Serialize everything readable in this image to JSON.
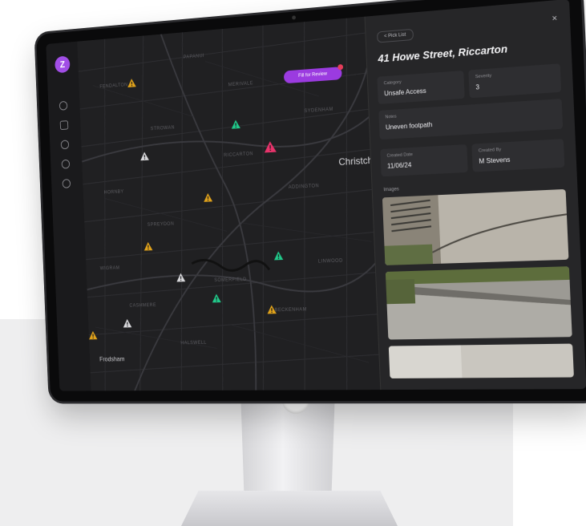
{
  "app": {
    "logo_letter": "Z",
    "accent_color": "#9b3be0"
  },
  "sidebar": {
    "items": [
      {
        "icon": "home-icon"
      },
      {
        "icon": "list-icon"
      },
      {
        "icon": "search-icon"
      },
      {
        "icon": "bell-icon"
      },
      {
        "icon": "settings-icon"
      }
    ]
  },
  "map": {
    "city_label": "Christchu",
    "suburb_label": "Frodsham",
    "filter_button_label": "Fill for Review",
    "street_labels": [
      "FENDALTON",
      "MERIVALE",
      "RICCARTON",
      "ADDINGTON",
      "SPREYDON",
      "SYDENHAM",
      "LINWOOD",
      "PAPANUI",
      "STROWAN",
      "BECKENHAM",
      "HALSWELL",
      "WIGRAM",
      "HORNBY",
      "SOMERFIELD",
      "CASHMERE"
    ],
    "markers": [
      {
        "status": "pending",
        "color": "#e0a21b"
      },
      {
        "status": "resolved",
        "color": "#21c98a"
      },
      {
        "status": "new",
        "color": "#d9d9dc"
      },
      {
        "status": "selected",
        "color": "#e8336b"
      },
      {
        "status": "pending",
        "color": "#e0a21b"
      },
      {
        "status": "pending",
        "color": "#e0a21b"
      },
      {
        "status": "resolved",
        "color": "#21c98a"
      },
      {
        "status": "new",
        "color": "#d9d9dc"
      },
      {
        "status": "resolved",
        "color": "#21c98a"
      },
      {
        "status": "pending",
        "color": "#e0a21b"
      },
      {
        "status": "new",
        "color": "#d9d9dc"
      },
      {
        "status": "pending",
        "color": "#e0a21b"
      }
    ]
  },
  "panel": {
    "back_label": "< Pick List",
    "close_label": "×",
    "title": "41 Howe Street, Riccarton",
    "fields": {
      "category_label": "Category",
      "category_value": "Unsafe Access",
      "severity_label": "Severity",
      "severity_value": "3",
      "notes_label": "Notes",
      "notes_value": "Uneven footpath",
      "created_date_label": "Created Date",
      "created_date_value": "11/06/24",
      "created_by_label": "Created By",
      "created_by_value": "M Stevens"
    },
    "images_label": "Images"
  }
}
